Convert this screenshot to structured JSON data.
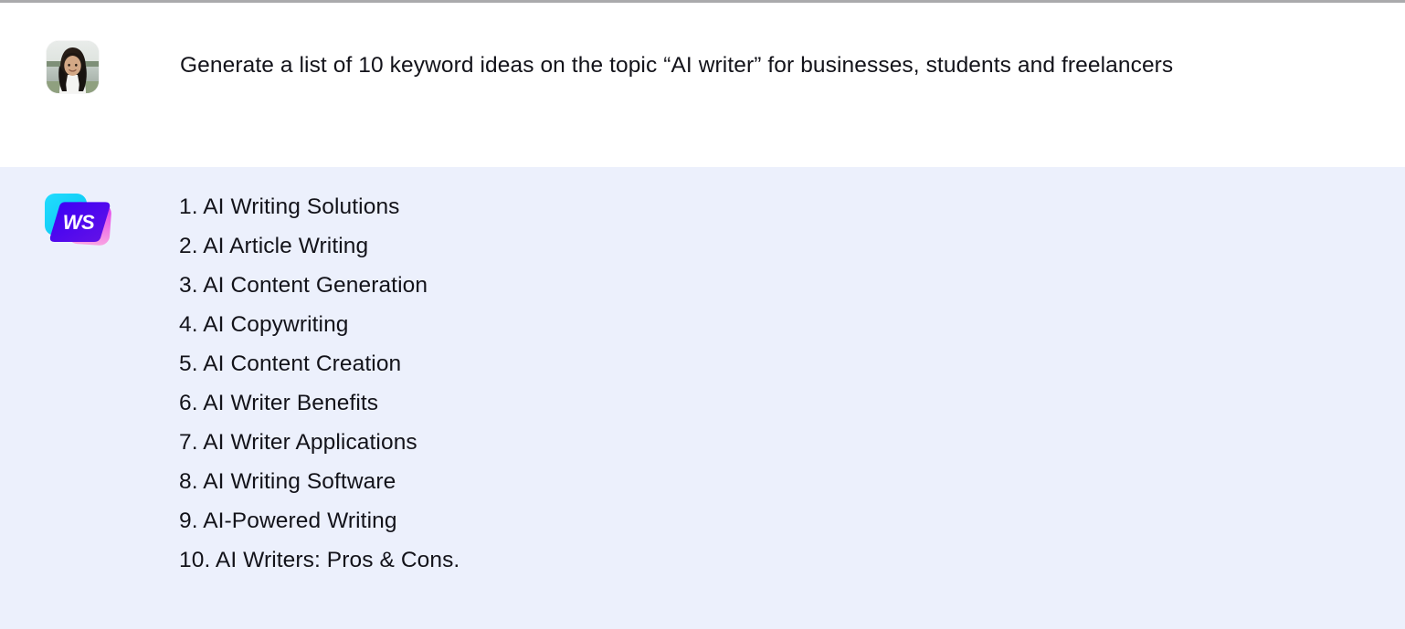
{
  "colors": {
    "page_background": "#ffffff",
    "answer_background": "#ecf0fc",
    "top_rule": "#aaaaac",
    "text": "#13131a",
    "logo_cyan": "#17d4f7",
    "logo_magenta": "#e84fe0",
    "logo_magenta_light": "#f58fe0",
    "logo_blue": "#3b05f2",
    "logo_blue_dark": "#5a10e8"
  },
  "user_turn": {
    "avatar": {
      "icon": "user-avatar-photo",
      "alt": "Profile photo of a smiling person outdoors"
    },
    "message": "Generate a list of 10 keyword ideas on the topic “AI writer” for businesses, students and freelancers"
  },
  "assistant_turn": {
    "logo": {
      "icon": "ws-writesonic-logo",
      "label": "WS"
    },
    "items": [
      "1. AI Writing Solutions",
      "2. AI Article Writing",
      "3. AI Content Generation",
      "4. AI Copywriting",
      "5. AI Content Creation",
      "6. AI Writer Benefits",
      "7. AI Writer Applications",
      "8. AI Writing Software",
      "9. AI-Powered Writing",
      "10. AI Writers: Pros & Cons."
    ]
  }
}
